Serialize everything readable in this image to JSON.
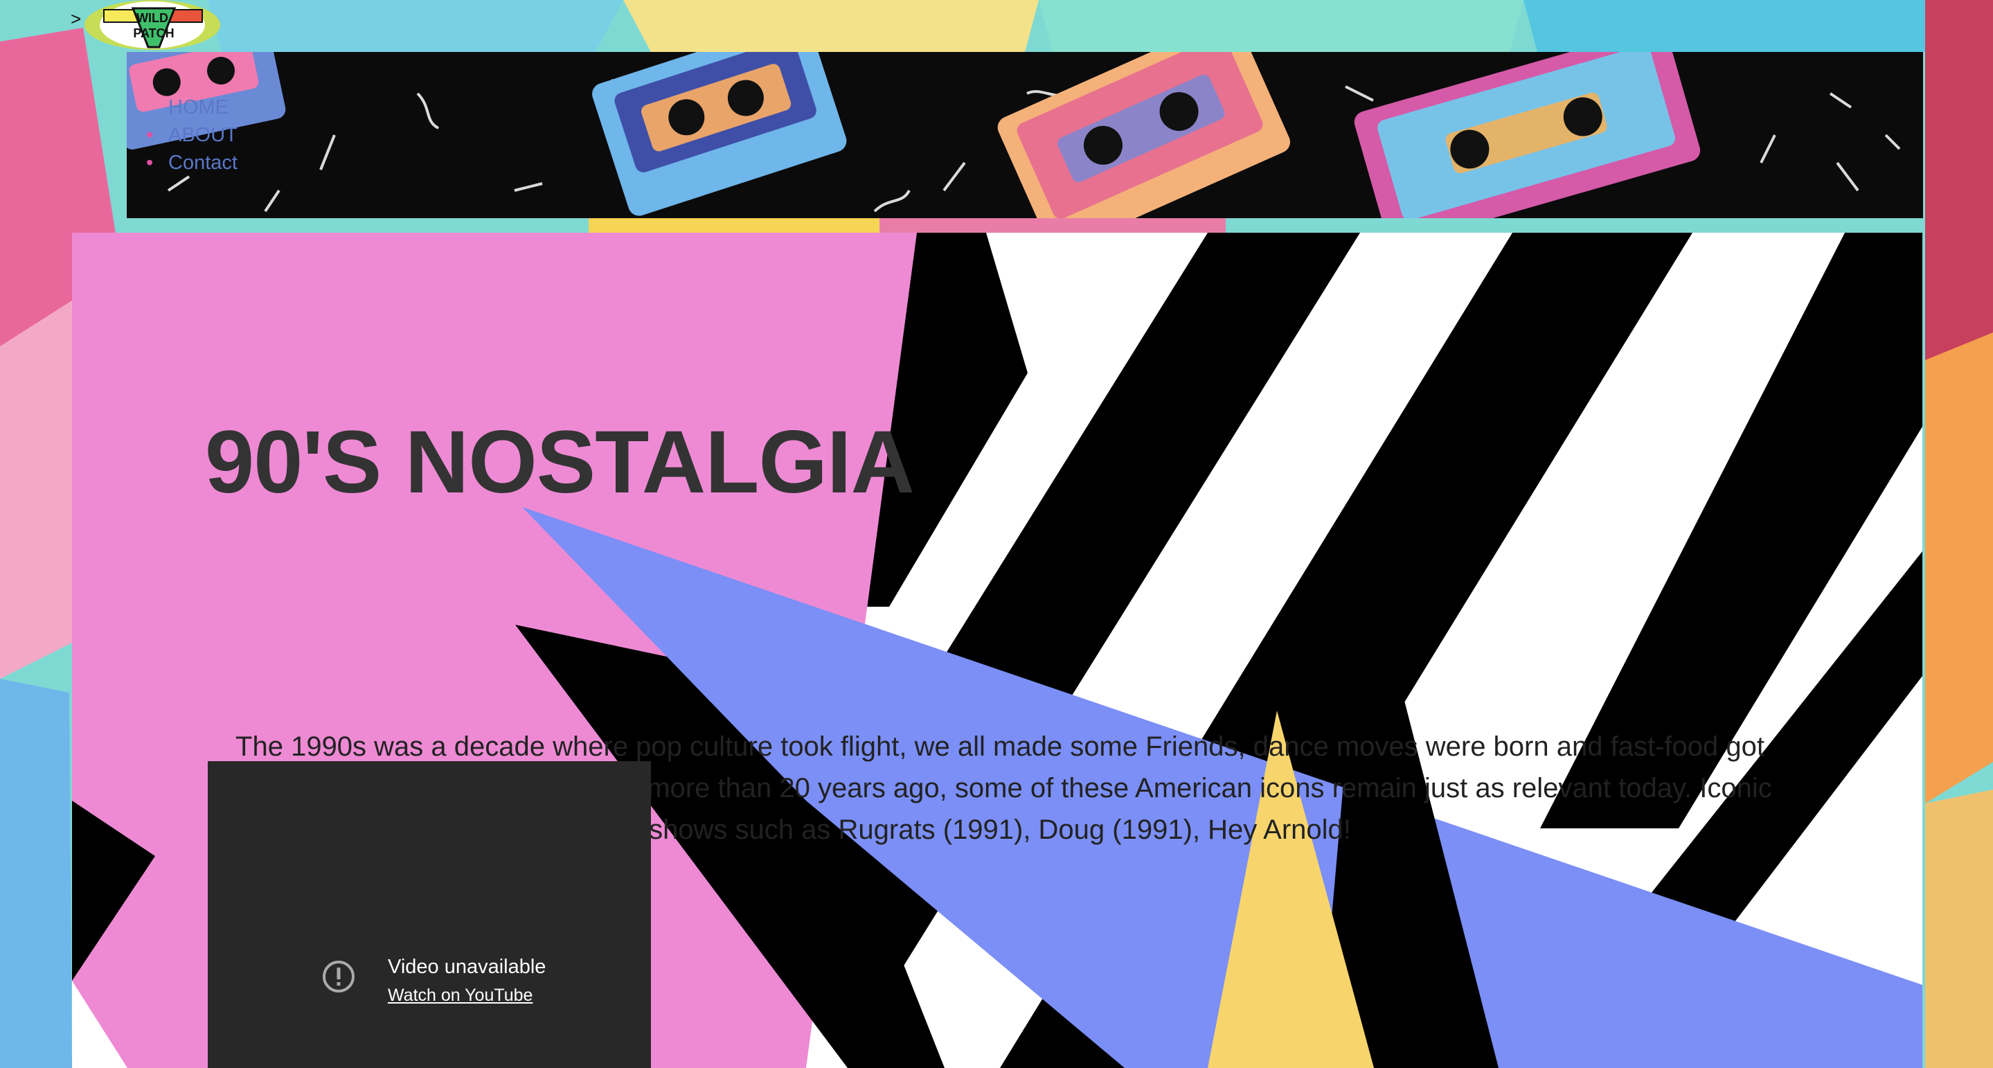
{
  "logo": {
    "caret": ">",
    "alt": "WILD PATCH"
  },
  "nav": {
    "items": [
      "HOME",
      "ABOUT",
      "Contact"
    ]
  },
  "hero": {
    "title": "90'S NOSTALGIA",
    "body": "The 1990s was a decade where pop culture took flight, we all made some Friends, dance moves were born and fast-food got even bigger. Although they ended more than 20 years ago, some of these American icons remain just as relevant today. Iconic shows such as Rugrats (1991), Doug (1991), Hey Arnold!"
  },
  "video": {
    "status": "Video unavailable",
    "link": "Watch on YouTube"
  },
  "colors": {
    "pink": "#ee8ad4",
    "blue": "#7b8ff6",
    "yellow": "#f7d56c",
    "teal": "#7fd9d3",
    "text": "#333333"
  }
}
